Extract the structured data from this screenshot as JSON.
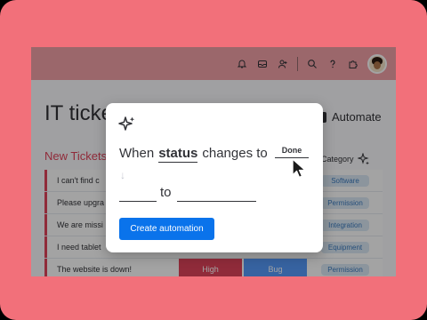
{
  "board": {
    "title": "IT tickets",
    "automate_label": "Automate",
    "group_title": "New Tickets",
    "category_header": "Category"
  },
  "rows": [
    {
      "task": "I can't find c",
      "category": "Software"
    },
    {
      "task": "Please upgra",
      "category": "Permission"
    },
    {
      "task": "We are missi",
      "category": "Integration"
    },
    {
      "task": "I need tablet",
      "category": "Equipment"
    },
    {
      "task": "The website is down!",
      "category": "Permission",
      "priority": "High",
      "type": "Bug"
    }
  ],
  "modal": {
    "when_label": "When",
    "column_keyword": "status",
    "changes_to_label": "changes to",
    "trigger_value": "Done",
    "to_label": "to",
    "create_button": "Create automation"
  },
  "colors": {
    "background": "#f2707a",
    "topbar": "#f3a2a8",
    "group_accent": "#e2445c",
    "primary_button": "#0a73eb",
    "priority_high": "#e2445c",
    "type_bug": "#579bfc"
  },
  "icons": [
    "bell-icon",
    "inbox-icon",
    "invite-user-icon",
    "search-icon",
    "help-icon",
    "apps-icon",
    "sparkle-icon",
    "robot-icon",
    "arrow-down-icon",
    "cursor-icon"
  ]
}
